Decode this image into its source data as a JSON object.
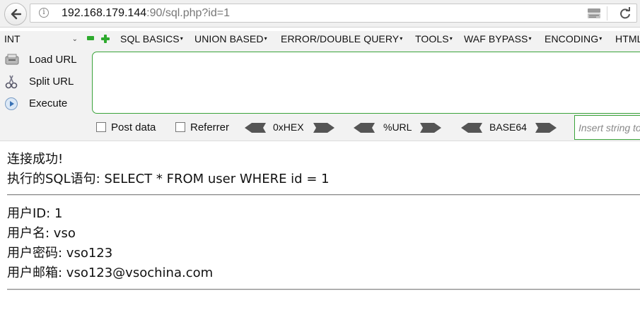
{
  "browser": {
    "url_host": "192.168.179.144",
    "url_rest": ":90/sql.php?id=1"
  },
  "hackbar": {
    "type_select": "INT",
    "menus": [
      {
        "label": "SQL BASICS"
      },
      {
        "label": "UNION BASED"
      },
      {
        "label": "ERROR/DOUBLE QUERY"
      },
      {
        "label": "TOOLS"
      },
      {
        "label": "WAF BYPASS"
      },
      {
        "label": "ENCODING"
      },
      {
        "label": "HTML"
      }
    ],
    "load_url": "Load URL",
    "split_url": "Split URL",
    "execute": "Execute",
    "post_data": "Post data",
    "referrer": "Referrer",
    "hex": "0xHEX",
    "url_enc": "%URL",
    "base64": "BASE64",
    "insert_placeholder": "Insert string to replace"
  },
  "page": {
    "connect_msg": "连接成功!",
    "sql_label": "执行的SQL语句: SELECT * FROM user WHERE id = 1",
    "user_id": "用户ID: 1",
    "user_name": "用户名: vso",
    "user_password": "用户密码: vso123",
    "user_email": "用户邮箱: vso123@vsochina.com"
  },
  "colors": {
    "accent_green": "#3aa33a",
    "toolbar_bg": "#f2f2f2"
  }
}
